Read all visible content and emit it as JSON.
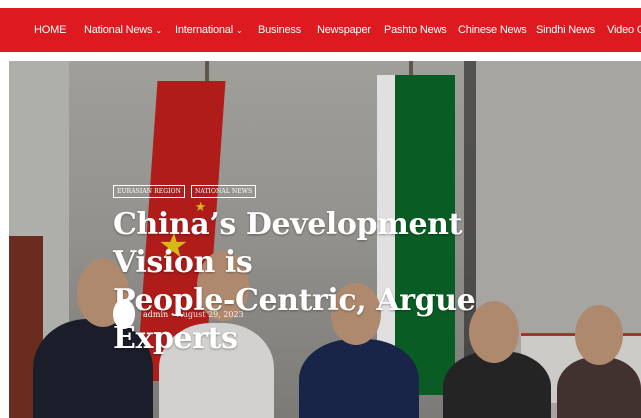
{
  "navigation": {
    "items": [
      {
        "label": "HOME",
        "has_dropdown": false
      },
      {
        "label": "National News",
        "has_dropdown": true
      },
      {
        "label": "International",
        "has_dropdown": true
      },
      {
        "label": "Business",
        "has_dropdown": false
      },
      {
        "label": "Newspaper",
        "has_dropdown": false
      },
      {
        "label": "Pashto News",
        "has_dropdown": false
      },
      {
        "label": "Chinese News",
        "has_dropdown": false
      },
      {
        "label": "Sindhi News",
        "has_dropdown": false
      },
      {
        "label": "Video Ga",
        "has_dropdown": false
      }
    ],
    "caret_glyph": "⌄",
    "background_color": "#dd1a1f"
  },
  "article": {
    "categories": [
      "EURASIAN REGION",
      "NATIONAL NEWS"
    ],
    "title_line1": "China’s Development Vision is",
    "title_line2": "People-Centric, Argue Experts",
    "author": "admin",
    "separator": "•",
    "date": "August 29, 2023"
  },
  "hero_image": {
    "subject": "group-photo-with-flags"
  }
}
